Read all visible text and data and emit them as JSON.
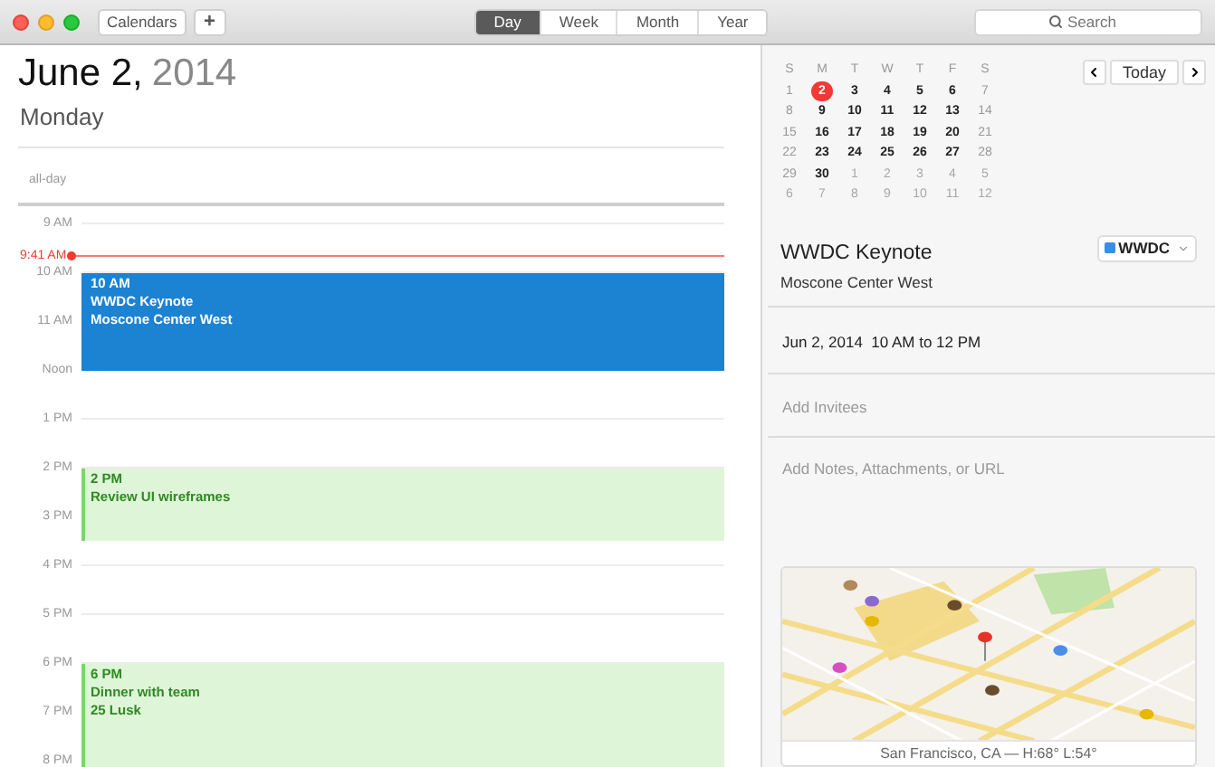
{
  "toolbar": {
    "calendars_button": "Calendars",
    "add_button": "+",
    "views": [
      {
        "label": "Day",
        "selected": true
      },
      {
        "label": "Week",
        "selected": false
      },
      {
        "label": "Month",
        "selected": false
      },
      {
        "label": "Year",
        "selected": false
      }
    ],
    "search": {
      "placeholder": "Search"
    }
  },
  "day_view": {
    "date": "June 2,",
    "year": "2014",
    "weekday": "Monday",
    "all_day_label": "all-day",
    "hours": [
      {
        "label": "9 AM",
        "now": "9:41 AM"
      },
      {
        "label": "10 AM",
        "events": [
          {
            "kind": "filled-2h",
            "color": "#1c82d2",
            "time": "10 AM",
            "title": "WWDC Keynote",
            "location": "Moscone Center West"
          }
        ]
      },
      {
        "label": "11 AM"
      },
      {
        "label": "Noon"
      },
      {
        "label": "1 PM"
      },
      {
        "label": "2 PM",
        "events": [
          {
            "kind": "tinted-90m",
            "color": "#7fd36f",
            "time": "2 PM",
            "title": "Review UI wireframes"
          }
        ]
      },
      {
        "label": "3 PM"
      },
      {
        "label": "4 PM"
      },
      {
        "label": "5 PM"
      },
      {
        "label": "6 PM",
        "events": [
          {
            "kind": "tinted-open",
            "color": "#7fd36f",
            "time": "6 PM",
            "title": "Dinner with team",
            "location": "25 Lusk"
          }
        ]
      },
      {
        "label": "7 PM"
      },
      {
        "label": "8 PM"
      }
    ]
  },
  "mini_calendar": {
    "weekdays": [
      "S",
      "M",
      "T",
      "W",
      "T",
      "F",
      "S"
    ],
    "days": [
      {
        "label": "1",
        "kind": "weekend"
      },
      {
        "label": "2",
        "kind": "today"
      },
      {
        "label": "3",
        "kind": "weekday"
      },
      {
        "label": "4",
        "kind": "weekday"
      },
      {
        "label": "5",
        "kind": "weekday"
      },
      {
        "label": "6",
        "kind": "weekday"
      },
      {
        "label": "7",
        "kind": "weekend"
      },
      {
        "label": "8",
        "kind": "weekend"
      },
      {
        "label": "9",
        "kind": "weekday"
      },
      {
        "label": "10",
        "kind": "weekday"
      },
      {
        "label": "11",
        "kind": "weekday"
      },
      {
        "label": "12",
        "kind": "weekday"
      },
      {
        "label": "13",
        "kind": "weekday"
      },
      {
        "label": "14",
        "kind": "weekend"
      },
      {
        "label": "15",
        "kind": "weekend"
      },
      {
        "label": "16",
        "kind": "weekday"
      },
      {
        "label": "17",
        "kind": "weekday"
      },
      {
        "label": "18",
        "kind": "weekday"
      },
      {
        "label": "19",
        "kind": "weekday"
      },
      {
        "label": "20",
        "kind": "weekday"
      },
      {
        "label": "21",
        "kind": "weekend"
      },
      {
        "label": "22",
        "kind": "weekend"
      },
      {
        "label": "23",
        "kind": "weekday"
      },
      {
        "label": "24",
        "kind": "weekday"
      },
      {
        "label": "25",
        "kind": "weekday"
      },
      {
        "label": "26",
        "kind": "weekday"
      },
      {
        "label": "27",
        "kind": "weekday"
      },
      {
        "label": "28",
        "kind": "weekend"
      },
      {
        "label": "29",
        "kind": "weekend"
      },
      {
        "label": "30",
        "kind": "weekday"
      },
      {
        "label": "1",
        "kind": "outside"
      },
      {
        "label": "2",
        "kind": "outside"
      },
      {
        "label": "3",
        "kind": "outside"
      },
      {
        "label": "4",
        "kind": "outside"
      },
      {
        "label": "5",
        "kind": "outside"
      },
      {
        "label": "6",
        "kind": "outside"
      },
      {
        "label": "7",
        "kind": "outside"
      },
      {
        "label": "8",
        "kind": "outside"
      },
      {
        "label": "9",
        "kind": "outside"
      },
      {
        "label": "10",
        "kind": "outside"
      },
      {
        "label": "11",
        "kind": "outside"
      },
      {
        "label": "12",
        "kind": "outside"
      }
    ],
    "today_button": "Today"
  },
  "event_detail": {
    "title": "WWDC Keynote",
    "location": "Moscone Center West",
    "calendar": {
      "name": "WWDC",
      "color": "#3a8ee6"
    },
    "when": "Jun 2, 2014  10 AM to 12 PM",
    "invitees_placeholder": "Add Invitees",
    "notes_placeholder": "Add Notes, Attachments, or URL",
    "map_caption": "San Francisco, CA — H:68° L:54°"
  }
}
